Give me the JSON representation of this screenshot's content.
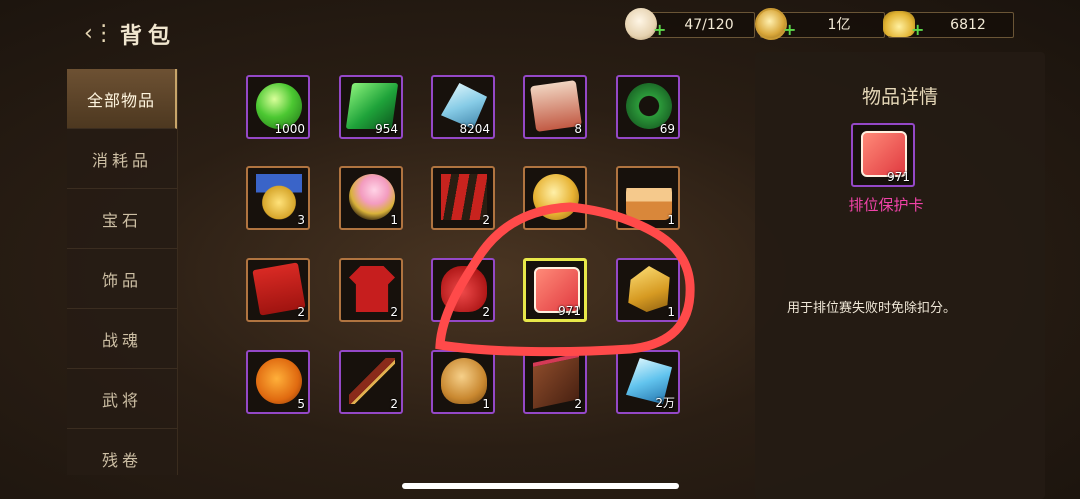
{
  "header": {
    "title": "背包",
    "back_icon": "back-arrow-icon"
  },
  "resources": {
    "bun": {
      "value": "47/120",
      "icon": "steamed-bun-icon"
    },
    "coin": {
      "value": "1亿",
      "icon": "copper-coin-icon"
    },
    "ingot": {
      "value": "6812",
      "icon": "gold-ingot-icon"
    }
  },
  "sidebar": {
    "tabs": [
      {
        "label": "全部物品",
        "active": true
      },
      {
        "label": "消耗品"
      },
      {
        "label": "宝石"
      },
      {
        "label": "饰品"
      },
      {
        "label": "战魂"
      },
      {
        "label": "武将"
      },
      {
        "label": "残卷"
      }
    ]
  },
  "inventory": {
    "items": [
      {
        "icon": "green-paw-orb-icon",
        "count": "1000",
        "rarity": "purple"
      },
      {
        "icon": "emerald-gem-icon",
        "count": "954",
        "rarity": "purple"
      },
      {
        "icon": "blue-crystal-icon",
        "count": "8204",
        "rarity": "purple"
      },
      {
        "icon": "red-scroll-icon",
        "count": "8",
        "rarity": "purple"
      },
      {
        "icon": "jade-wreath-icon",
        "count": "69",
        "rarity": "purple"
      },
      {
        "icon": "gold-star-medal-icon",
        "count": "3",
        "rarity": "orange"
      },
      {
        "icon": "plum-blossom-icon",
        "count": "1",
        "rarity": "orange"
      },
      {
        "icon": "spring-couplet-icon",
        "count": "2",
        "rarity": "orange"
      },
      {
        "icon": "gold-coin-icon",
        "count": "",
        "rarity": "orange"
      },
      {
        "icon": "birthday-cake-icon",
        "count": "1",
        "rarity": "orange"
      },
      {
        "icon": "red-envelope-icon",
        "count": "2",
        "rarity": "orange"
      },
      {
        "icon": "red-jersey-icon",
        "count": "2",
        "rarity": "orange"
      },
      {
        "icon": "red-lucky-bag-icon",
        "count": "2",
        "rarity": "purple"
      },
      {
        "icon": "rank-protection-card-icon",
        "count": "971",
        "rarity": "selected"
      },
      {
        "icon": "gold-bricks-icon",
        "count": "1",
        "rarity": "purple"
      },
      {
        "icon": "jack-o-lantern-icon",
        "count": "5",
        "rarity": "purple"
      },
      {
        "icon": "firecracker-stick-icon",
        "count": "2",
        "rarity": "purple"
      },
      {
        "icon": "roast-chicken-icon",
        "count": "1",
        "rarity": "purple"
      },
      {
        "icon": "chocolate-bar-icon",
        "count": "2",
        "rarity": "purple"
      },
      {
        "icon": "ice-crystal-icon",
        "count": "2万",
        "rarity": "purple"
      }
    ]
  },
  "detail": {
    "title": "物品详情",
    "item_icon": "rank-protection-card-icon",
    "item_count": "971",
    "item_name": "排位保护卡",
    "description": "用于排位赛失败时免除扣分。",
    "name_color": "#f043a8"
  },
  "annotation": {
    "color": "#ff4a4a"
  }
}
